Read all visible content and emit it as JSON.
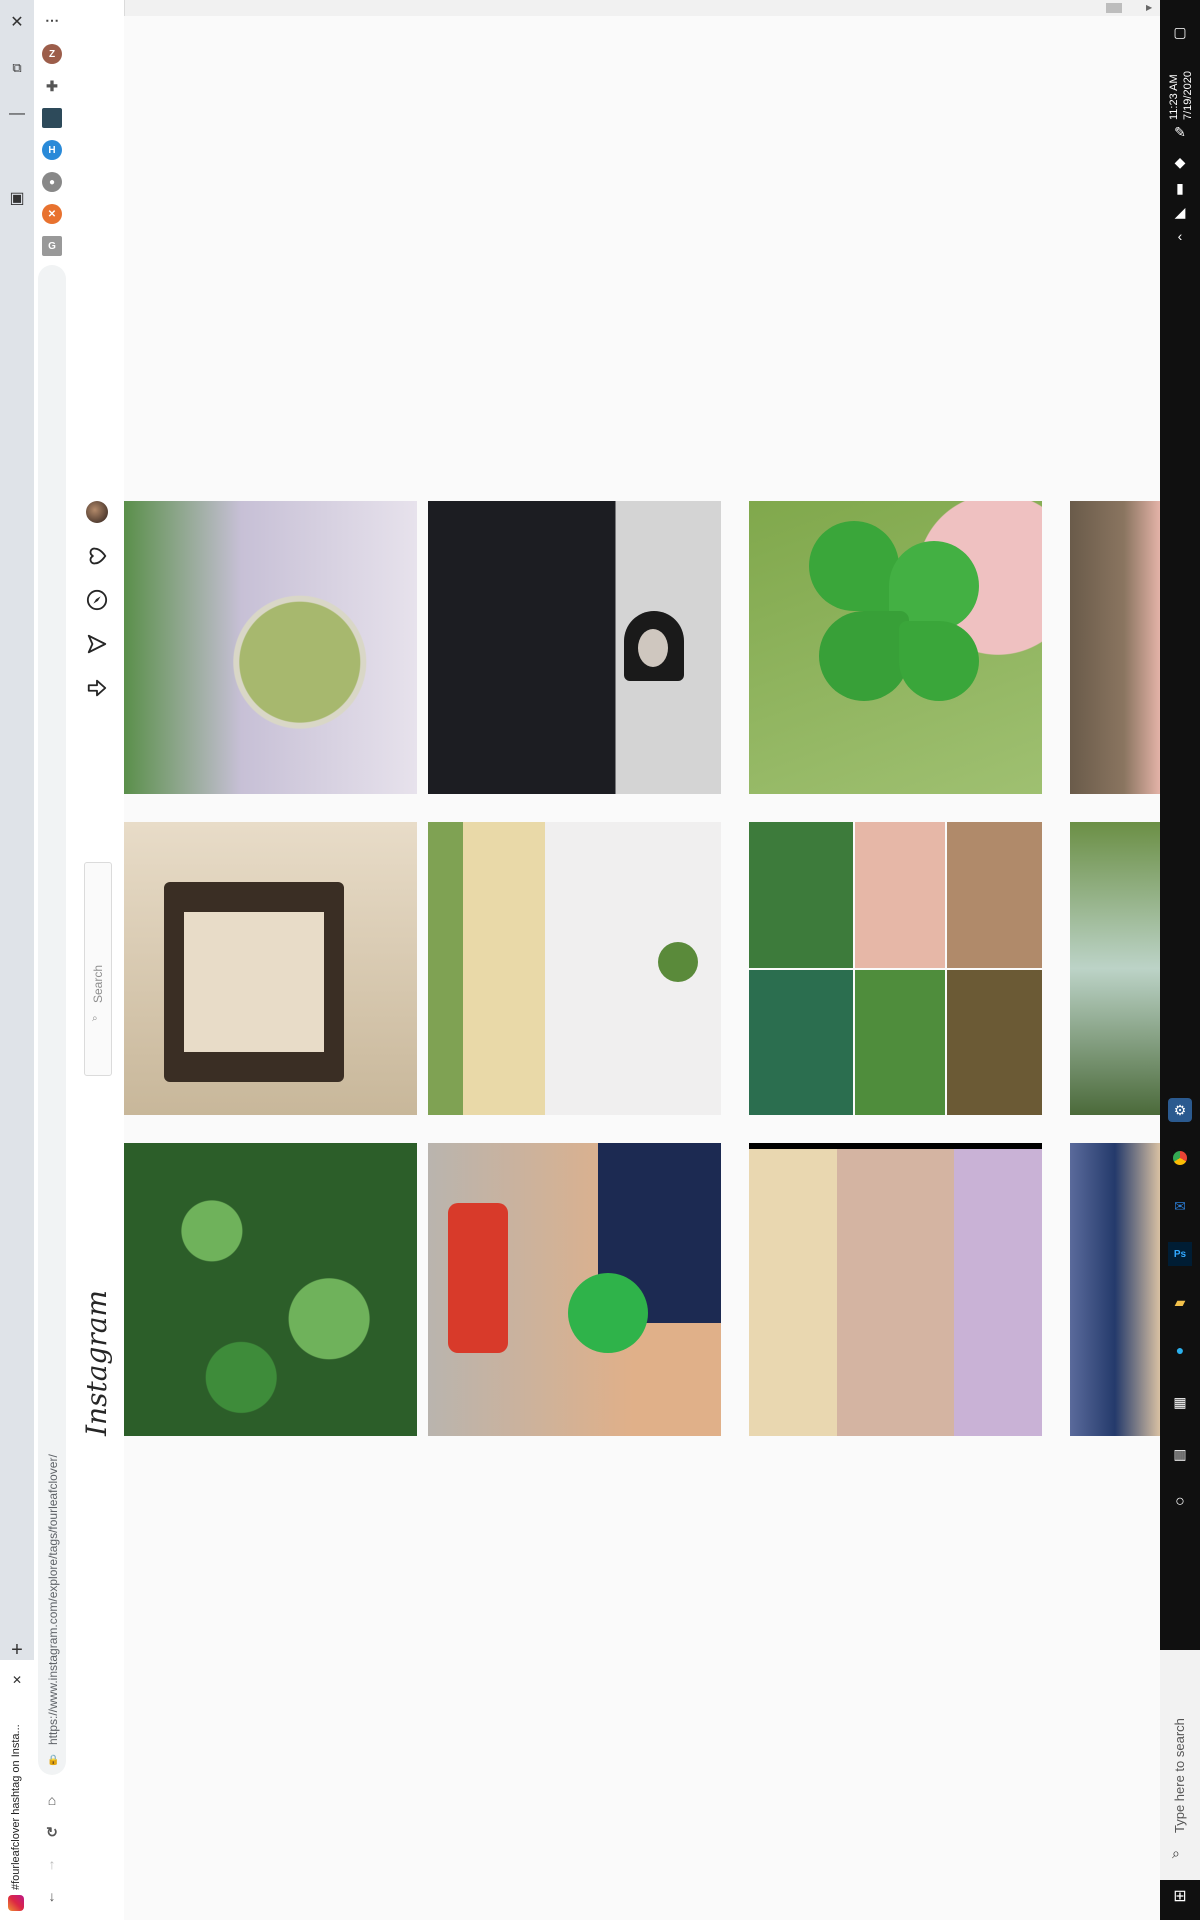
{
  "browser": {
    "tab_title": "#fourleafclover hashtag on Insta...",
    "url": "https://www.instagram.com/explore/tags/fourleafclover/",
    "menu_icon": "more-icon",
    "new_tab_icon": "plus-icon",
    "close_tab_icon": "close-icon"
  },
  "instagram": {
    "logo": "Instagram",
    "search_placeholder": "Search",
    "nav_icons": [
      "home-icon",
      "direct-icon",
      "explore-icon",
      "activity-icon",
      "profile-avatar"
    ]
  },
  "extensions": [
    "Z",
    "puzzle",
    "image",
    "H",
    "circle",
    "X",
    "G"
  ],
  "posts": [
    {
      "row": 1,
      "col": 1,
      "desc": "clover-pendant",
      "colors": [
        "#c7c0d6",
        "#a7b86e",
        "#4a7a3a"
      ]
    },
    {
      "row": 1,
      "col": 2,
      "desc": "cat-mask-figure",
      "colors": [
        "#1c1d22",
        "#d4d4d4",
        "#2a2a2a"
      ]
    },
    {
      "row": 1,
      "col": 3,
      "desc": "four-leaf-clover-closeup",
      "colors": [
        "#3aa63a",
        "#efc1c1",
        "#80a84c"
      ]
    },
    {
      "row": 1,
      "col": 4,
      "desc": "clover-in-grass",
      "colors": [
        "#6a5b4a",
        "#5d8a4a",
        "#e4b3a8"
      ]
    },
    {
      "row": 2,
      "col": 1,
      "desc": "collage-condemned-tag",
      "colors": [
        "#e8dcc8",
        "#3a2e24",
        "#c8b79a"
      ]
    },
    {
      "row": 2,
      "col": 2,
      "desc": "woman-holding-clover",
      "colors": [
        "#f0efef",
        "#e9d9a8",
        "#7fa253"
      ]
    },
    {
      "row": 2,
      "col": 3,
      "desc": "six-clover-grid",
      "colors": [
        "#3d7b3b",
        "#e6b7a7",
        "#2b6e4f"
      ]
    },
    {
      "row": 2,
      "col": 4,
      "desc": "trees-sky",
      "colors": [
        "#6b8f45",
        "#bcd3c7",
        "#4b6a3a"
      ]
    },
    {
      "row": 3,
      "col": 1,
      "desc": "clover-patch",
      "colors": [
        "#3e8c3a",
        "#6fb25b",
        "#2c5e29"
      ]
    },
    {
      "row": 3,
      "col": 2,
      "desc": "hand-with-clover-toys",
      "colors": [
        "#2fb34a",
        "#e0b089",
        "#1c2a52"
      ]
    },
    {
      "row": 3,
      "col": 3,
      "desc": "woman-portrait",
      "colors": [
        "#d4b4a2",
        "#c9b2d6",
        "#e9d7b0"
      ]
    },
    {
      "row": 3,
      "col": 4,
      "desc": "anime-art",
      "colors": [
        "#243a6b",
        "#d9c1a3",
        "#5a6a9b"
      ]
    }
  ],
  "taskbar": {
    "time": "11:23 AM",
    "date": "7/19/2020",
    "search_placeholder": "Type here to search"
  }
}
